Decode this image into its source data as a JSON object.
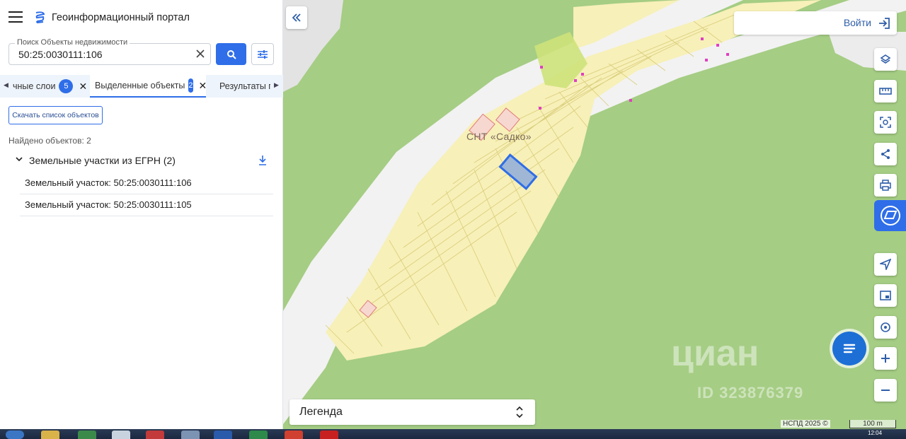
{
  "header": {
    "title": "Геоинформационный портал"
  },
  "search": {
    "label": "Поиск Объекты недвижимости",
    "value": "50:25:0030111:106"
  },
  "tabs": [
    {
      "label": "чные слои",
      "count": "5"
    },
    {
      "label": "Выделенные объекты",
      "count": "2"
    },
    {
      "label": "Результаты по"
    }
  ],
  "results": {
    "download_label": "Скачать список объектов",
    "found": "Найдено объектов: 2",
    "group_label": "Земельные участки из ЕГРН (2)",
    "items": [
      "Земельный участок: 50:25:0030111:106",
      "Земельный участок: 50:25:0030111:105"
    ]
  },
  "map": {
    "login_label": "Войти",
    "place_label": "СНТ «Садко»",
    "legend_label": "Легенда",
    "attribution": "НСПД 2025 ©",
    "scale_label": "100 m",
    "watermark": "циан",
    "watermark_id": "ID 323876379",
    "colors": {
      "forest": "#a5cd84",
      "parcels": "#f7f0b8",
      "selected": "#2f6ee8",
      "road": "#f4f4f4"
    }
  },
  "tools": [
    "layers-icon",
    "ruler-icon",
    "select-area-icon",
    "share-icon",
    "print-icon",
    "pkk-icon",
    "locate-icon",
    "minimap-icon",
    "geolocation-icon",
    "zoom-in-icon",
    "zoom-out-icon"
  ],
  "taskbar": {
    "clock": "12:04"
  }
}
